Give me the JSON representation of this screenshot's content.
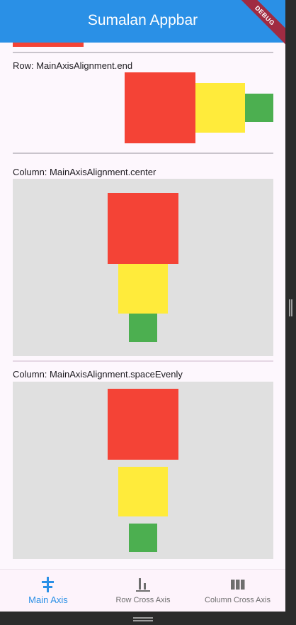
{
  "appbar": {
    "title": "Sumalan Appbar",
    "banner": "DEBUG"
  },
  "sections": {
    "row_end": {
      "label": "Row: MainAxisAlignment.end"
    },
    "column_center": {
      "label": "Column: MainAxisAlignment.center"
    },
    "column_space_evenly": {
      "label": "Column: MainAxisAlignment.spaceEvenly"
    }
  },
  "colors": {
    "appbar": "#2a90e6",
    "red": "#f44336",
    "yellow": "#ffeb3b",
    "green": "#4caf50",
    "panel": "#e0e0e0",
    "active": "#2a90e6"
  },
  "bottom_nav": {
    "items": [
      {
        "label": "Main Axis",
        "icon": "align-vertical-center-icon",
        "active": true
      },
      {
        "label": "Row Cross Axis",
        "icon": "align-bottom-bars-icon",
        "active": false
      },
      {
        "label": "Column Cross Axis",
        "icon": "view-columns-icon",
        "active": false
      }
    ]
  }
}
